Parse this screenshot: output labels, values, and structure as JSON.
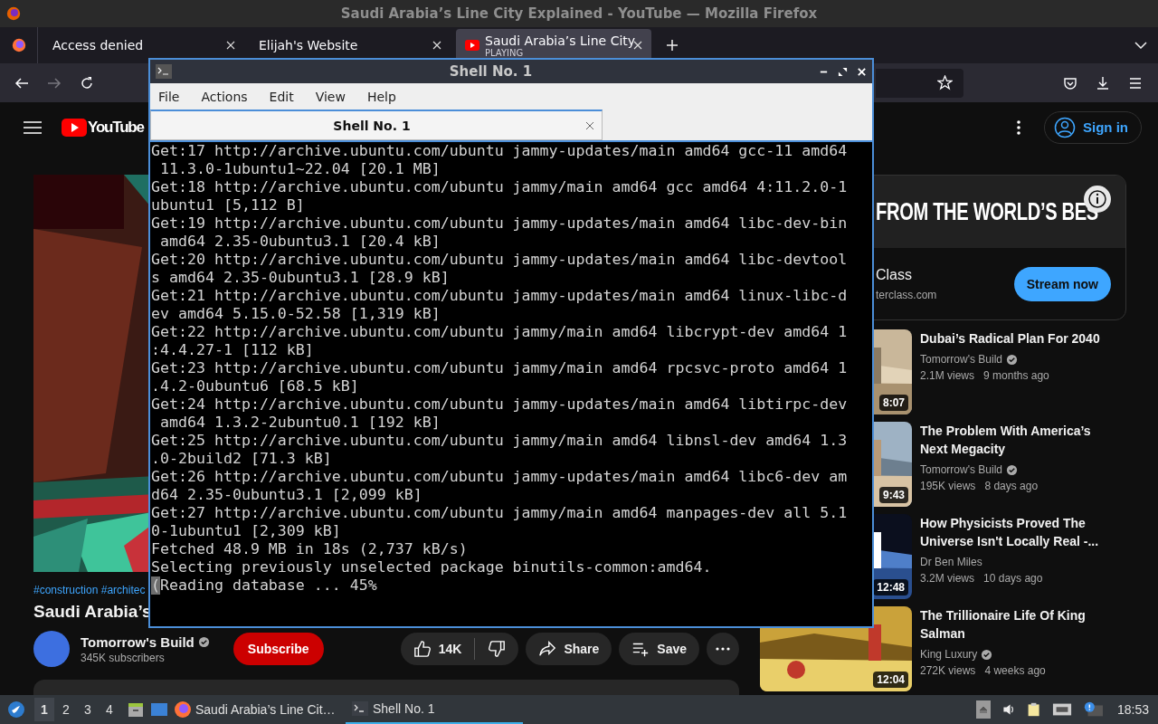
{
  "window": {
    "title": "Saudi Arabia’s Line City Explained - YouTube — Mozilla Firefox"
  },
  "browser_tabs": [
    {
      "label": "Access denied",
      "selected": false
    },
    {
      "label": "Elijah's Website",
      "selected": false
    },
    {
      "label": "Saudi Arabia’s Line City",
      "sublabel": "PLAYING",
      "selected": true
    }
  ],
  "nav": {
    "forward_disabled": true
  },
  "youtube": {
    "logo_text": "YouTube",
    "sign_in": "Sign in",
    "video": {
      "hashtags": "#construction #architec",
      "title": "Saudi Arabia’s",
      "channel": "Tomorrow's Build",
      "verified": true,
      "subscribers": "345K subscribers",
      "subscribe": "Subscribe",
      "likes": "14K",
      "share": "Share",
      "save": "Save"
    },
    "ad": {
      "headline": "FROM THE WORLD’S BES",
      "name": "Class",
      "domain": "terclass.com",
      "button": "Stream now"
    },
    "related": [
      {
        "title": "Dubai’s Radical Plan For 2040",
        "channel": "Tomorrow's Build",
        "verified": true,
        "views": "2.1M views",
        "age": "9 months ago",
        "duration": "8:07",
        "kind": "sand"
      },
      {
        "title": "The Problem With America’s Next Megacity",
        "channel": "Tomorrow's Build",
        "verified": true,
        "views": "195K views",
        "age": "8 days ago",
        "duration": "9:43",
        "kind": "sky"
      },
      {
        "title": "How Physicists Proved The Universe Isn't Locally Real -...",
        "channel": "Dr Ben Miles",
        "verified": false,
        "views": "3.2M views",
        "age": "10 days ago",
        "duration": "12:48",
        "kind": "space"
      },
      {
        "title": "The Trillionaire Life Of King Salman",
        "channel": "King Luxury",
        "verified": true,
        "views": "272K views",
        "age": "4 weeks ago",
        "duration": "12:04",
        "kind": "gold"
      }
    ]
  },
  "terminal": {
    "title": "Shell No. 1",
    "menu": [
      "File",
      "Actions",
      "Edit",
      "View",
      "Help"
    ],
    "tab": "Shell No. 1",
    "lines": [
      "Get:17 http://archive.ubuntu.com/ubuntu jammy-updates/main amd64 gcc-11 amd64",
      " 11.3.0-1ubuntu1~22.04 [20.1 MB]",
      "Get:18 http://archive.ubuntu.com/ubuntu jammy/main amd64 gcc amd64 4:11.2.0-1",
      "ubuntu1 [5,112 B]",
      "Get:19 http://archive.ubuntu.com/ubuntu jammy-updates/main amd64 libc-dev-bin",
      " amd64 2.35-0ubuntu3.1 [20.4 kB]",
      "Get:20 http://archive.ubuntu.com/ubuntu jammy-updates/main amd64 libc-devtool",
      "s amd64 2.35-0ubuntu3.1 [28.9 kB]",
      "Get:21 http://archive.ubuntu.com/ubuntu jammy-updates/main amd64 linux-libc-d",
      "ev amd64 5.15.0-52.58 [1,319 kB]",
      "Get:22 http://archive.ubuntu.com/ubuntu jammy/main amd64 libcrypt-dev amd64 1",
      ":4.4.27-1 [112 kB]",
      "Get:23 http://archive.ubuntu.com/ubuntu jammy/main amd64 rpcsvc-proto amd64 1",
      ".4.2-0ubuntu6 [68.5 kB]",
      "Get:24 http://archive.ubuntu.com/ubuntu jammy-updates/main amd64 libtirpc-dev",
      " amd64 1.3.2-2ubuntu0.1 [192 kB]",
      "Get:25 http://archive.ubuntu.com/ubuntu jammy/main amd64 libnsl-dev amd64 1.3",
      ".0-2build2 [71.3 kB]",
      "Get:26 http://archive.ubuntu.com/ubuntu jammy-updates/main amd64 libc6-dev am",
      "d64 2.35-0ubuntu3.1 [2,099 kB]",
      "Get:27 http://archive.ubuntu.com/ubuntu jammy/main amd64 manpages-dev all 5.1",
      "0-1ubuntu1 [2,309 kB]",
      "Fetched 48.9 MB in 18s (2,737 kB/s)",
      "Selecting previously unselected package binutils-common:amd64.",
      "(Reading database ... 45%"
    ]
  },
  "taskbar": {
    "workspaces": [
      {
        "label": "1",
        "selected": true
      },
      {
        "label": "2",
        "selected": false
      },
      {
        "label": "3",
        "selected": false
      },
      {
        "label": "4",
        "selected": false
      }
    ],
    "tasks": [
      {
        "label": "Saudi Arabia’s Line Cit…",
        "kind": "firefox",
        "selected": false
      },
      {
        "label": "Shell No. 1",
        "kind": "terminal",
        "selected": true
      }
    ],
    "clock": "18:53"
  }
}
